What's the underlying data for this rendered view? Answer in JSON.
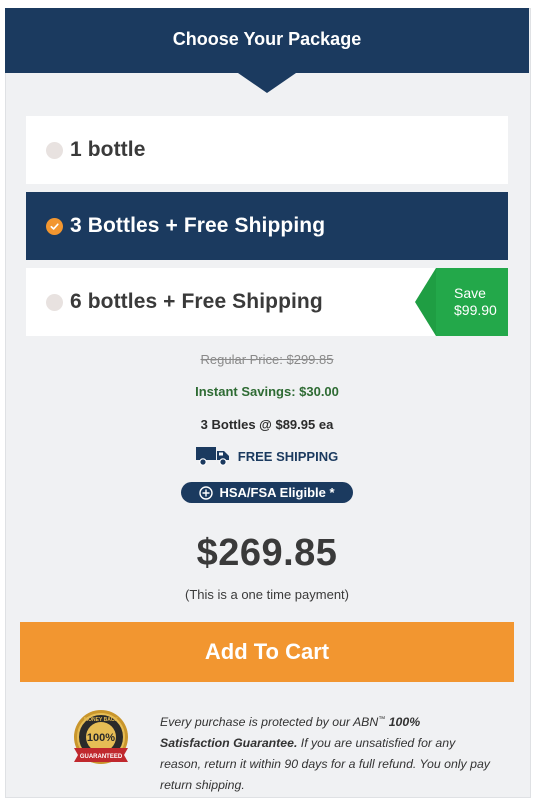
{
  "header": {
    "title": "Choose Your Package"
  },
  "options": [
    {
      "label": "1 bottle",
      "selected": false
    },
    {
      "label": "3 Bottles + Free Shipping",
      "selected": true
    },
    {
      "label": "6 bottles + Free Shipping",
      "selected": false,
      "badge_line1": "Save",
      "badge_line2": "$99.90"
    }
  ],
  "summary": {
    "regular_price": "Regular Price: $299.85",
    "instant_savings": "Instant Savings: $30.00",
    "per_bottle": "3 Bottles @ $89.95 ea",
    "shipping": "FREE SHIPPING",
    "hsa": "HSA/FSA Eligible *",
    "total": "$269.85",
    "payment_note": "(This is a one time payment)"
  },
  "cart": {
    "button_label": "Add To Cart"
  },
  "guarantee": {
    "badge_top": "MONEY BACK",
    "badge_center": "100%",
    "badge_banner": "GUARANTEED",
    "text_intro": "Every purchase is protected by our ABN",
    "trademark": "™",
    "text_bold": "100% Satisfaction Guarantee.",
    "text_rest": "If you are unsatisfied for any reason, return it within 90 days for a full refund. You only pay return shipping."
  },
  "colors": {
    "navy": "#1b3a5f",
    "orange": "#f29630",
    "green": "#23a84a"
  }
}
